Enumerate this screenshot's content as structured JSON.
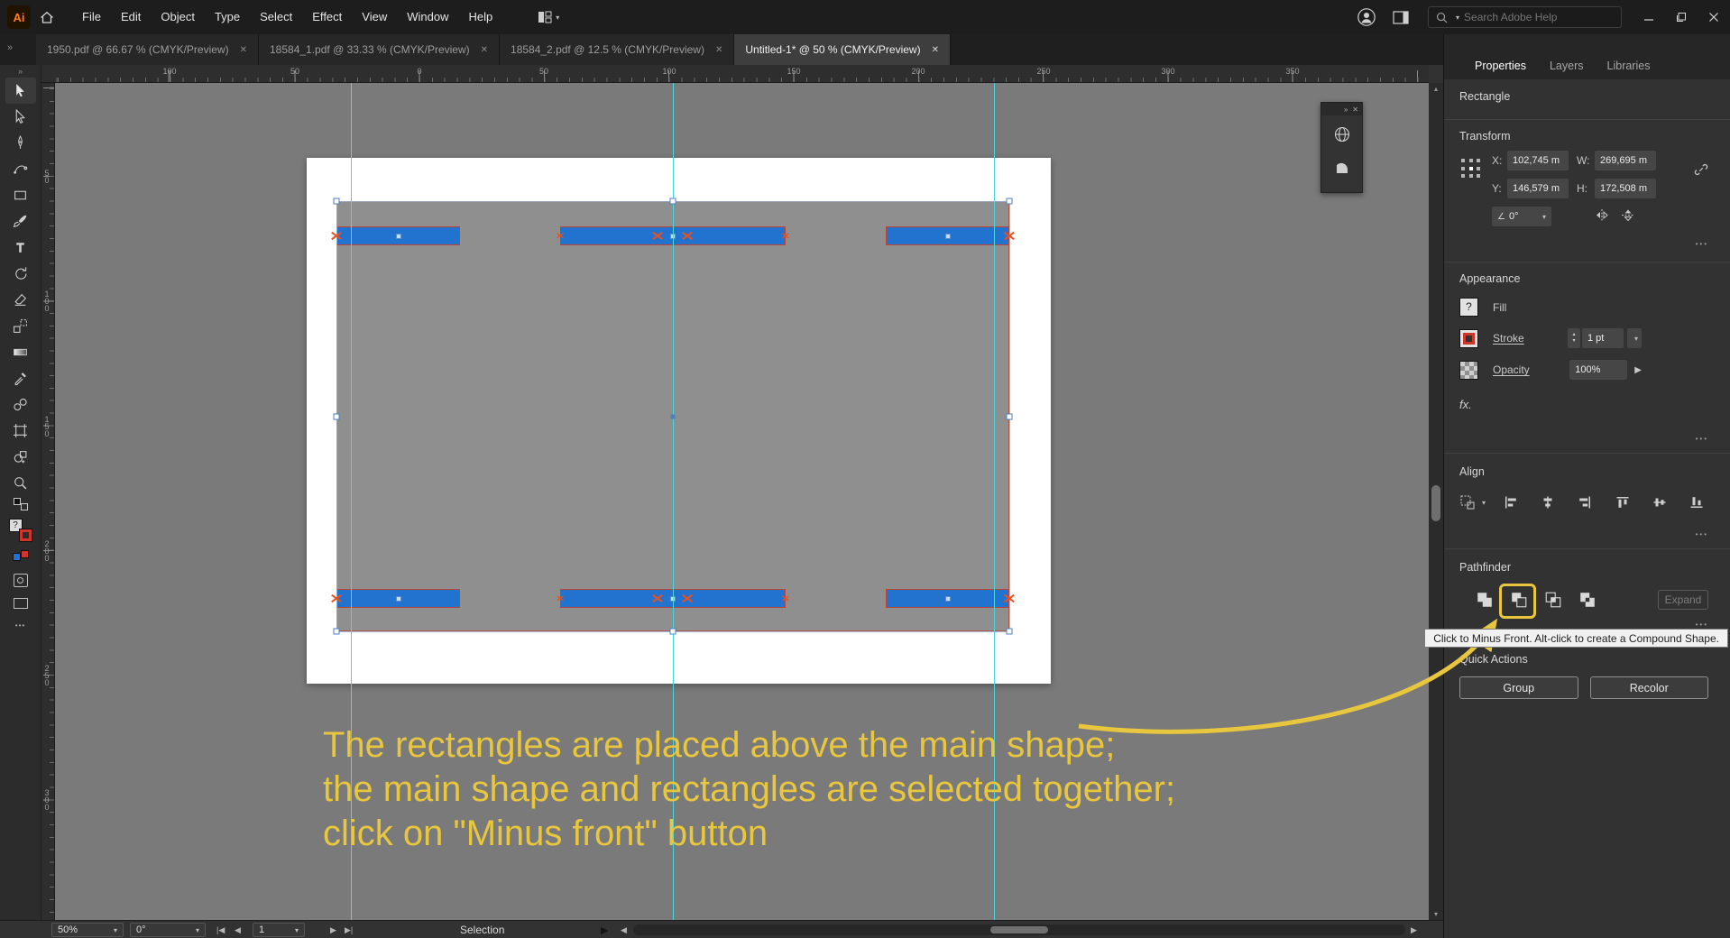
{
  "titlebar": {
    "logo": "Ai",
    "menus": [
      "File",
      "Edit",
      "Object",
      "Type",
      "Select",
      "Effect",
      "View",
      "Window",
      "Help"
    ],
    "search_placeholder": "Search Adobe Help"
  },
  "tabs": [
    {
      "label": "1950.pdf @ 66.67 % (CMYK/Preview)",
      "active": false
    },
    {
      "label": "18584_1.pdf @ 33.33 % (CMYK/Preview)",
      "active": false
    },
    {
      "label": "18584_2.pdf @ 12.5 % (CMYK/Preview)",
      "active": false
    },
    {
      "label": "Untitled-1* @ 50 % (CMYK/Preview)",
      "active": true
    }
  ],
  "toolbar": {
    "tools": [
      "selection-tool",
      "direct-selection-tool",
      "pen-tool",
      "curvature-tool",
      "rectangle-tool",
      "paintbrush-tool",
      "type-tool",
      "rotate-tool",
      "eraser-tool",
      "scale-tool",
      "gradient-tool",
      "eyedropper-tool",
      "blend-tool",
      "artboard-tool",
      "shape-builder-tool",
      "zoom-tool"
    ]
  },
  "rulers": {
    "top": [
      "100",
      "50",
      "0",
      "50",
      "100",
      "150",
      "200",
      "250",
      "300",
      "350"
    ],
    "left": [
      "50",
      "100",
      "150",
      "200",
      "250",
      "300"
    ]
  },
  "panel": {
    "tabs": [
      "Properties",
      "Layers",
      "Libraries"
    ],
    "object_type": "Rectangle",
    "transform": {
      "title": "Transform",
      "x_label": "X:",
      "x_value": "102,745 m",
      "y_label": "Y:",
      "y_value": "146,579 m",
      "w_label": "W:",
      "w_value": "269,695 m",
      "h_label": "H:",
      "h_value": "172,508 m",
      "angle_value": "0°"
    },
    "appearance": {
      "title": "Appearance",
      "fill_label": "Fill",
      "stroke_label": "Stroke",
      "stroke_weight": "1 pt",
      "opacity_label": "Opacity",
      "opacity_value": "100%",
      "fx_label": "fx."
    },
    "align": {
      "title": "Align"
    },
    "pathfinder": {
      "title": "Pathfinder",
      "expand_label": "Expand"
    },
    "tooltip": "Click to Minus Front. Alt-click to create a Compound Shape.",
    "quick_actions": {
      "title": "Quick Actions",
      "group_label": "Group",
      "recolor_label": "Recolor"
    }
  },
  "statusbar": {
    "zoom": "50%",
    "rotation": "0°",
    "artboard_number": "1",
    "tool_status": "Selection"
  },
  "annotation": {
    "lines": [
      "The rectangles are placed above the main shape;",
      "the main shape and rectangles are selected together;",
      "click on \"Minus front\" button"
    ],
    "color": "#e8c63e"
  },
  "colors": {
    "accent_blue": "#2273d0",
    "guide_cyan": "#45d8e2",
    "artwork_stroke_red": "#c2442e",
    "annotation_yellow": "#e8c63e"
  },
  "glyphs": {
    "unknown": "?",
    "close": "✕",
    "chevron_down": "▾",
    "chevron_up": "▴",
    "ellipsis": "•••",
    "collapse": "»",
    "angle": "∠",
    "first": "|◀",
    "prev": "◀",
    "next": "▶",
    "last": "▶|",
    "left": "◀",
    "right": "▶",
    "popup": "▶"
  }
}
